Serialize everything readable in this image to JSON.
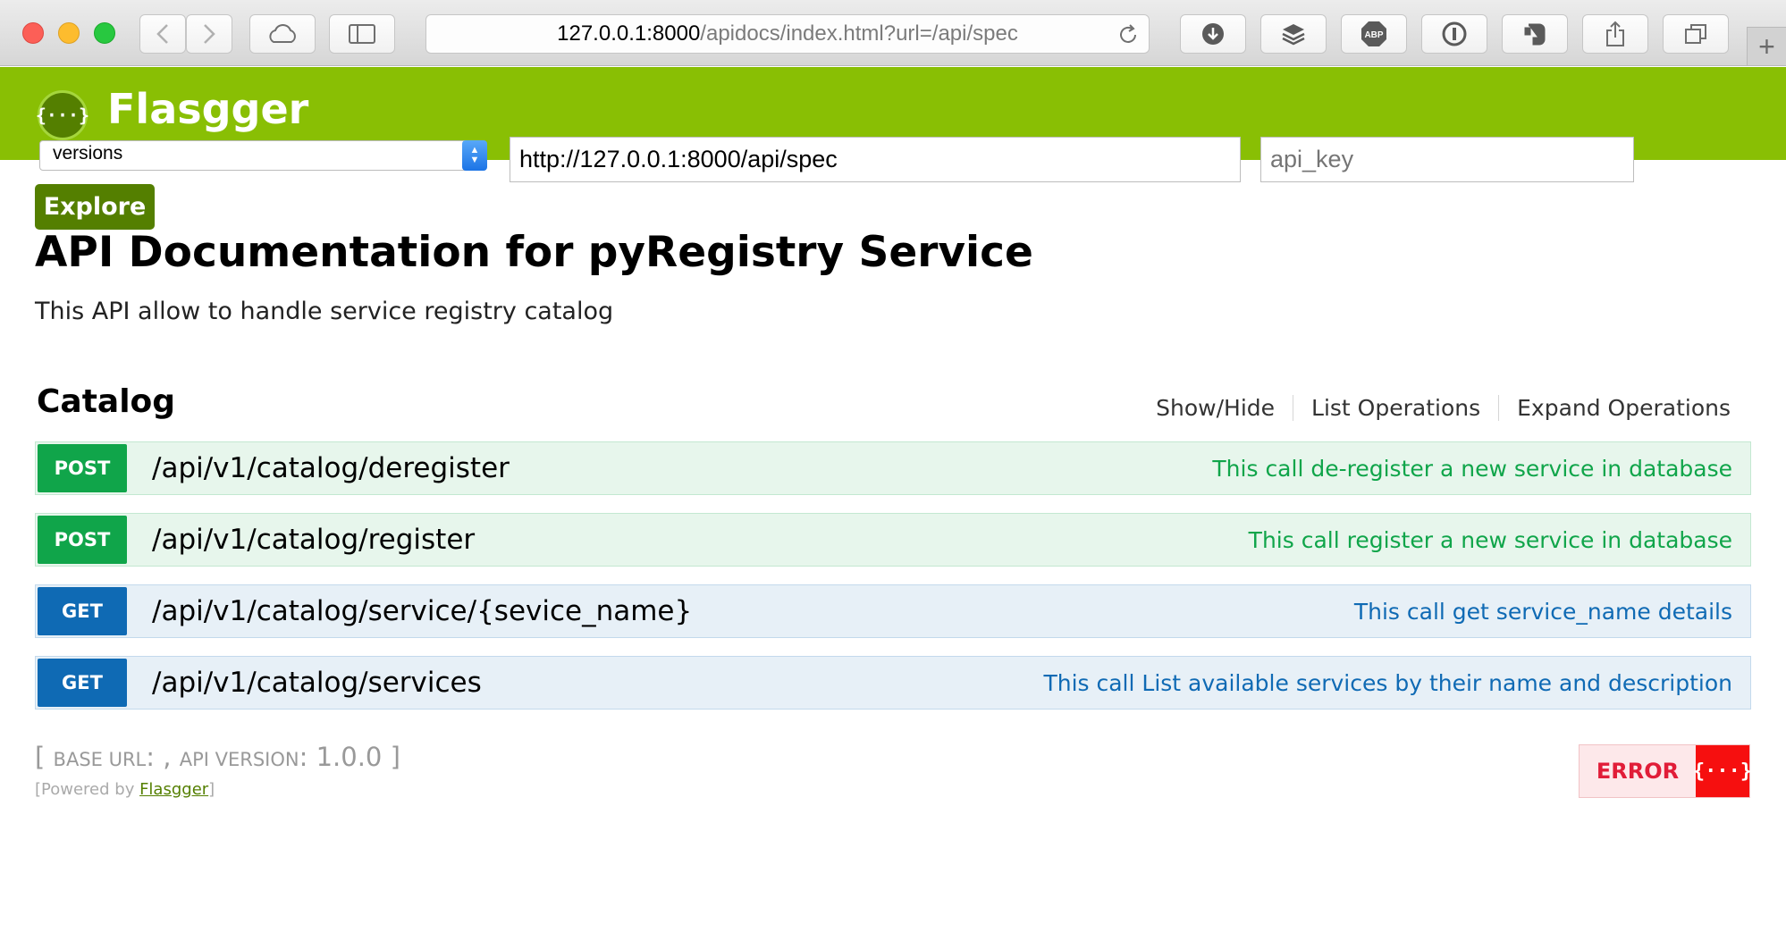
{
  "browser": {
    "address_host": "127.0.0.1:8000",
    "address_path": "/apidocs/index.html?url=/api/spec",
    "new_tab_label": "+"
  },
  "header": {
    "brand": "Flasgger",
    "logo_glyph": "{···}",
    "versions_select": "versions",
    "spec_url": "http://127.0.0.1:8000/api/spec",
    "api_key_placeholder": "api_key",
    "explore_label": "Explore"
  },
  "info": {
    "title": "API Documentation for pyRegistry Service",
    "description": "This API allow to handle service registry catalog"
  },
  "resource": {
    "name": "Catalog",
    "nav": {
      "show_hide": "Show/Hide",
      "list_ops": "List Operations",
      "expand_ops": "Expand Operations"
    },
    "operations": [
      {
        "method": "POST",
        "path": "/api/v1/catalog/deregister",
        "summary": "This call de-register a new service in database"
      },
      {
        "method": "POST",
        "path": "/api/v1/catalog/register",
        "summary": "This call register a new service in database"
      },
      {
        "method": "GET",
        "path": "/api/v1/catalog/service/{sevice_name}",
        "summary": "This call get service_name details"
      },
      {
        "method": "GET",
        "path": "/api/v1/catalog/services",
        "summary": "This call List available services by their name and description"
      }
    ]
  },
  "footer": {
    "base_open": "[ ",
    "base_url_label": "BASE URL",
    "base_url_value": ": , ",
    "api_version_label": "API VERSION",
    "api_version_value": ": 1.0.0 ]",
    "powered_prefix": "[Powered by ",
    "powered_link": "Flasgger",
    "powered_suffix": "]",
    "validator_text": "ERROR",
    "validator_glyph": "{···}"
  },
  "colors": {
    "header_green": "#89bf04",
    "post_green": "#10a54a",
    "get_blue": "#0f6ab4",
    "error_red": "#f60f0f"
  }
}
